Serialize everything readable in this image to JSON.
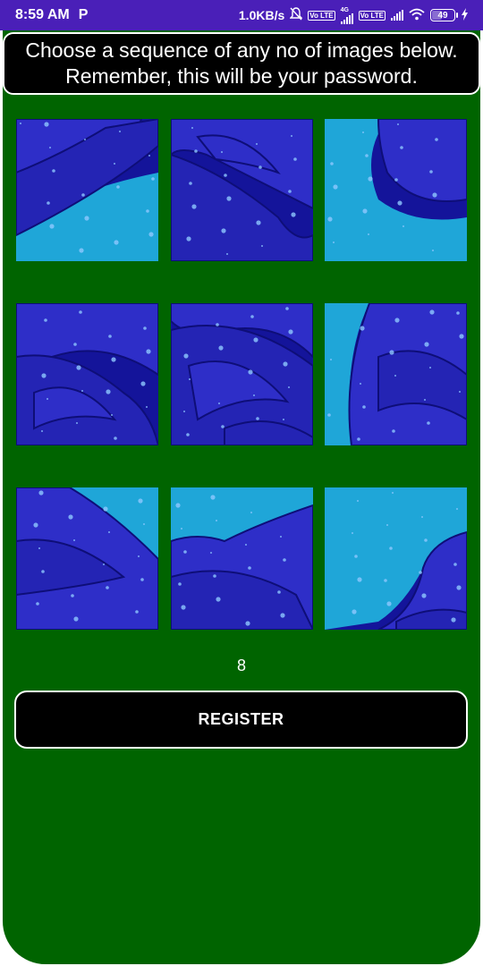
{
  "status_bar": {
    "time": "8:59 AM",
    "app_indicator": "P",
    "net_speed": "1.0KB/s",
    "network_badge_1": "4G",
    "volte_1": "Vo LTE",
    "volte_2": "Vo LTE",
    "battery_level": "49",
    "battery_fraction": 0.49,
    "icons": [
      "parking-notification-icon",
      "mute-bell-icon",
      "signal-icon",
      "signal-icon",
      "wifi-icon",
      "battery-icon",
      "charging-icon"
    ]
  },
  "instructions": {
    "line1": "Choose a sequence of any no of images below.",
    "line2": "Remember, this will be your password."
  },
  "image_grid": {
    "rows": 3,
    "columns": 3,
    "tiles": [
      {
        "label": "rose-piece-1"
      },
      {
        "label": "rose-piece-2"
      },
      {
        "label": "rose-piece-3"
      },
      {
        "label": "rose-piece-4"
      },
      {
        "label": "rose-piece-5"
      },
      {
        "label": "rose-piece-6"
      },
      {
        "label": "rose-piece-7"
      },
      {
        "label": "rose-piece-8"
      },
      {
        "label": "rose-piece-9"
      }
    ]
  },
  "counter": "8",
  "register_label": "REGISTER",
  "colors": {
    "status_bar": "#4a1fb8",
    "background": "#006400",
    "petal": "#2e2ec8",
    "petal_dark": "#14149a",
    "sky": "#1fa6d8"
  }
}
